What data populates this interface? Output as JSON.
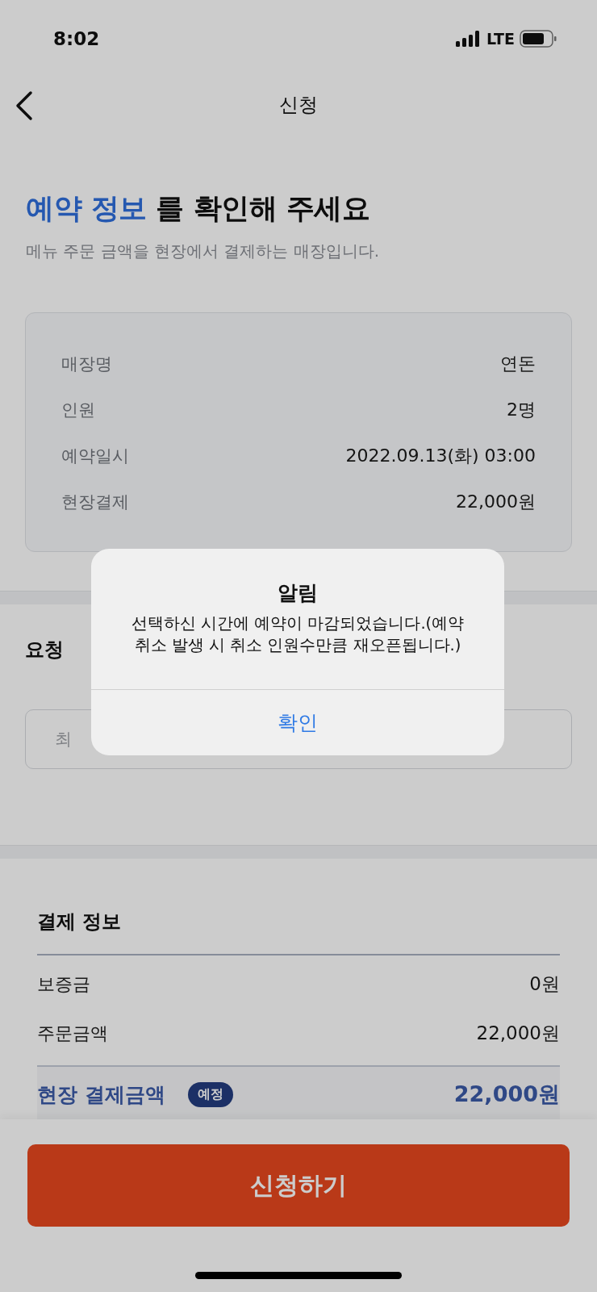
{
  "status_bar": {
    "time": "8:02",
    "network": "LTE"
  },
  "nav": {
    "title": "신청"
  },
  "heading": {
    "highlight": "예약 정보",
    "rest": "를 확인해 주세요"
  },
  "subtitle": "메뉴 주문 금액을 현장에서 결제하는 매장입니다.",
  "reservation": [
    {
      "label": "매장명",
      "value": "연돈"
    },
    {
      "label": "인원",
      "value": "2명"
    },
    {
      "label": "예약일시",
      "value": "2022.09.13(화) 03:00"
    },
    {
      "label": "현장결제",
      "value": "22,000원"
    }
  ],
  "request": {
    "title": "요청",
    "placeholder": "최"
  },
  "payment": {
    "title": "결제 정보",
    "rows": [
      {
        "label": "보증금",
        "value": "0원"
      },
      {
        "label": "주문금액",
        "value": "22,000원"
      }
    ],
    "total": {
      "label": "현장 결제금액",
      "badge": "예정",
      "value": "22,000원"
    }
  },
  "submit_button": "신청하기",
  "alert": {
    "title": "알림",
    "message": "선택하신 시간에 예약이 마감되었습니다.(예약 취소 발생 시 취소 인원수만큼 재오픈됩니다.)",
    "button": "확인"
  }
}
